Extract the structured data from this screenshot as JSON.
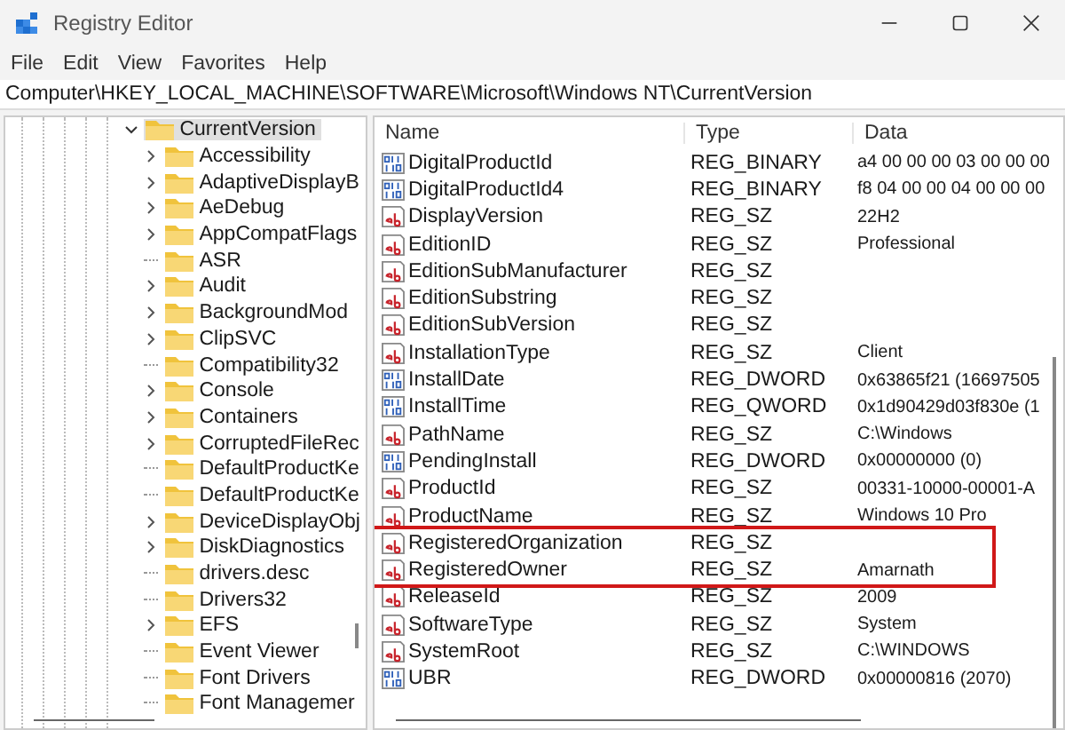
{
  "window": {
    "title": "Registry Editor"
  },
  "menu": [
    "File",
    "Edit",
    "View",
    "Favorites",
    "Help"
  ],
  "address": "Computer\\HKEY_LOCAL_MACHINE\\SOFTWARE\\Microsoft\\Windows NT\\CurrentVersion",
  "tree": {
    "label": "CurrentVersion",
    "expanded": true,
    "selected": true,
    "children": [
      {
        "label": "Accessibility",
        "expandable": true
      },
      {
        "label": "AdaptiveDisplayB",
        "expandable": true
      },
      {
        "label": "AeDebug",
        "expandable": true
      },
      {
        "label": "AppCompatFlags",
        "expandable": true
      },
      {
        "label": "ASR",
        "expandable": false
      },
      {
        "label": "Audit",
        "expandable": true
      },
      {
        "label": "BackgroundMod",
        "expandable": true
      },
      {
        "label": "ClipSVC",
        "expandable": true
      },
      {
        "label": "Compatibility32",
        "expandable": false
      },
      {
        "label": "Console",
        "expandable": true
      },
      {
        "label": "Containers",
        "expandable": true
      },
      {
        "label": "CorruptedFileRec",
        "expandable": true
      },
      {
        "label": "DefaultProductKe",
        "expandable": false
      },
      {
        "label": "DefaultProductKe",
        "expandable": false
      },
      {
        "label": "DeviceDisplayObj",
        "expandable": true
      },
      {
        "label": "DiskDiagnostics",
        "expandable": true
      },
      {
        "label": "drivers.desc",
        "expandable": false
      },
      {
        "label": "Drivers32",
        "expandable": false
      },
      {
        "label": "EFS",
        "expandable": true
      },
      {
        "label": "Event Viewer",
        "expandable": false
      },
      {
        "label": "Font Drivers",
        "expandable": false
      },
      {
        "label": "Font Managemer",
        "expandable": false
      }
    ]
  },
  "table": {
    "columns": [
      "Name",
      "Type",
      "Data"
    ],
    "rows": [
      {
        "kind": "binary",
        "name": "DigitalProductId",
        "type": "REG_BINARY",
        "data": "a4 00 00 00 03 00 00 00",
        "highlighted": false
      },
      {
        "kind": "binary",
        "name": "DigitalProductId4",
        "type": "REG_BINARY",
        "data": "f8 04 00 00 04 00 00 00",
        "highlighted": false
      },
      {
        "kind": "string",
        "name": "DisplayVersion",
        "type": "REG_SZ",
        "data": "22H2",
        "highlighted": false
      },
      {
        "kind": "string",
        "name": "EditionID",
        "type": "REG_SZ",
        "data": "Professional",
        "highlighted": false
      },
      {
        "kind": "string",
        "name": "EditionSubManufacturer",
        "type": "REG_SZ",
        "data": "",
        "highlighted": false
      },
      {
        "kind": "string",
        "name": "EditionSubstring",
        "type": "REG_SZ",
        "data": "",
        "highlighted": false
      },
      {
        "kind": "string",
        "name": "EditionSubVersion",
        "type": "REG_SZ",
        "data": "",
        "highlighted": false
      },
      {
        "kind": "string",
        "name": "InstallationType",
        "type": "REG_SZ",
        "data": "Client",
        "highlighted": false
      },
      {
        "kind": "binary",
        "name": "InstallDate",
        "type": "REG_DWORD",
        "data": "0x63865f21 (16697505",
        "highlighted": false
      },
      {
        "kind": "binary",
        "name": "InstallTime",
        "type": "REG_QWORD",
        "data": "0x1d90429d03f830e (1",
        "highlighted": false
      },
      {
        "kind": "string",
        "name": "PathName",
        "type": "REG_SZ",
        "data": "C:\\Windows",
        "highlighted": false
      },
      {
        "kind": "binary",
        "name": "PendingInstall",
        "type": "REG_DWORD",
        "data": "0x00000000 (0)",
        "highlighted": false
      },
      {
        "kind": "string",
        "name": "ProductId",
        "type": "REG_SZ",
        "data": "00331-10000-00001-A",
        "highlighted": false
      },
      {
        "kind": "string",
        "name": "ProductName",
        "type": "REG_SZ",
        "data": "Windows 10 Pro",
        "highlighted": false
      },
      {
        "kind": "string",
        "name": "RegisteredOrganization",
        "type": "REG_SZ",
        "data": "",
        "highlighted": true
      },
      {
        "kind": "string",
        "name": "RegisteredOwner",
        "type": "REG_SZ",
        "data": "Amarnath",
        "highlighted": true
      },
      {
        "kind": "string",
        "name": "ReleaseId",
        "type": "REG_SZ",
        "data": "2009",
        "highlighted": false
      },
      {
        "kind": "string",
        "name": "SoftwareType",
        "type": "REG_SZ",
        "data": "System",
        "highlighted": false
      },
      {
        "kind": "string",
        "name": "SystemRoot",
        "type": "REG_SZ",
        "data": "C:\\WINDOWS",
        "highlighted": false
      },
      {
        "kind": "binary",
        "name": "UBR",
        "type": "REG_DWORD",
        "data": "0x00000816 (2070)",
        "highlighted": false
      }
    ]
  }
}
